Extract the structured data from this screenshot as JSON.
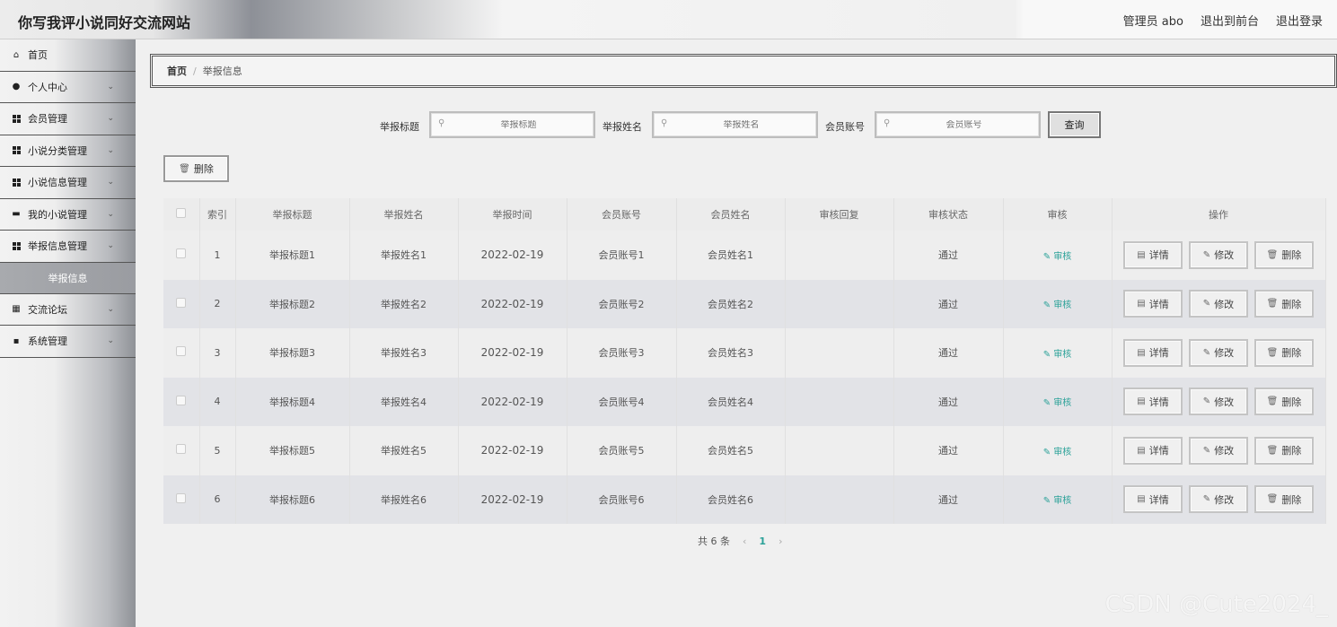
{
  "header": {
    "title": "你写我评小说同好交流网站",
    "user": "管理员 abo",
    "to_front": "退出到前台",
    "logout": "退出登录"
  },
  "sidebar": {
    "items": [
      {
        "label": "首页",
        "icon": "home-icon"
      },
      {
        "label": "个人中心",
        "icon": "user-icon"
      },
      {
        "label": "会员管理",
        "icon": "grid-icon"
      },
      {
        "label": "小说分类管理",
        "icon": "grid-icon"
      },
      {
        "label": "小说信息管理",
        "icon": "grid-icon"
      },
      {
        "label": "我的小说管理",
        "icon": "monitor-icon"
      },
      {
        "label": "举报信息管理",
        "icon": "grid-icon"
      },
      {
        "label": "交流论坛",
        "icon": "chart-icon"
      },
      {
        "label": "系统管理",
        "icon": "briefcase-icon"
      }
    ],
    "submenu": {
      "label": "举报信息"
    }
  },
  "breadcrumb": {
    "home": "首页",
    "separator": "/",
    "current": "举报信息"
  },
  "search": {
    "title_label": "举报标题",
    "title_placeholder": "举报标题",
    "name_label": "举报姓名",
    "name_placeholder": "举报姓名",
    "account_label": "会员账号",
    "account_placeholder": "会员账号",
    "query_button": "查询"
  },
  "toolbar": {
    "delete_label": "删除"
  },
  "table": {
    "headers": [
      "索引",
      "举报标题",
      "举报姓名",
      "举报时间",
      "会员账号",
      "会员姓名",
      "审核回复",
      "审核状态",
      "审核",
      "操作"
    ],
    "rows": [
      {
        "index": "1",
        "title": "举报标题1",
        "name": "举报姓名1",
        "time": "2022-02-19",
        "account": "会员账号1",
        "member": "会员姓名1",
        "reply": "",
        "status": "通过"
      },
      {
        "index": "2",
        "title": "举报标题2",
        "name": "举报姓名2",
        "time": "2022-02-19",
        "account": "会员账号2",
        "member": "会员姓名2",
        "reply": "",
        "status": "通过"
      },
      {
        "index": "3",
        "title": "举报标题3",
        "name": "举报姓名3",
        "time": "2022-02-19",
        "account": "会员账号3",
        "member": "会员姓名3",
        "reply": "",
        "status": "通过"
      },
      {
        "index": "4",
        "title": "举报标题4",
        "name": "举报姓名4",
        "time": "2022-02-19",
        "account": "会员账号4",
        "member": "会员姓名4",
        "reply": "",
        "status": "通过"
      },
      {
        "index": "5",
        "title": "举报标题5",
        "name": "举报姓名5",
        "time": "2022-02-19",
        "account": "会员账号5",
        "member": "会员姓名5",
        "reply": "",
        "status": "通过"
      },
      {
        "index": "6",
        "title": "举报标题6",
        "name": "举报姓名6",
        "time": "2022-02-19",
        "account": "会员账号6",
        "member": "会员姓名6",
        "reply": "",
        "status": "通过"
      }
    ],
    "audit_label": "审核",
    "detail_label": "详情",
    "edit_label": "修改",
    "delete_label": "删除"
  },
  "pagination": {
    "total": "共 6 条",
    "current_page": "1"
  },
  "watermark": "CSDN @Cute2024_",
  "colors": {
    "accent": "#2aa198"
  }
}
